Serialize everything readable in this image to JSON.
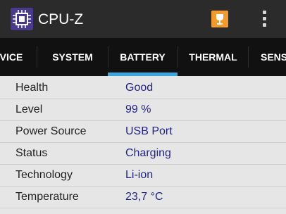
{
  "app": {
    "title": "CPU-Z",
    "icon": "cpu-chip-icon",
    "action_icon": "trophy-icon",
    "menu_icon": "overflow-menu-icon"
  },
  "tabs": [
    {
      "label": "VICE"
    },
    {
      "label": "SYSTEM"
    },
    {
      "label": "BATTERY",
      "active": true
    },
    {
      "label": "THERMAL"
    },
    {
      "label": "SENS"
    }
  ],
  "battery": {
    "rows": [
      {
        "label": "Health",
        "value": "Good"
      },
      {
        "label": "Level",
        "value": "99 %"
      },
      {
        "label": "Power Source",
        "value": "USB Port"
      },
      {
        "label": "Status",
        "value": "Charging"
      },
      {
        "label": "Technology",
        "value": "Li-ion"
      },
      {
        "label": "Temperature",
        "value": "23,7 °C"
      }
    ]
  },
  "colors": {
    "app_bar": "#2b2b2b",
    "tab_bar": "#111111",
    "accent": "#3aa6e0",
    "value_text": "#23238a",
    "background": "#e6e6e6"
  }
}
